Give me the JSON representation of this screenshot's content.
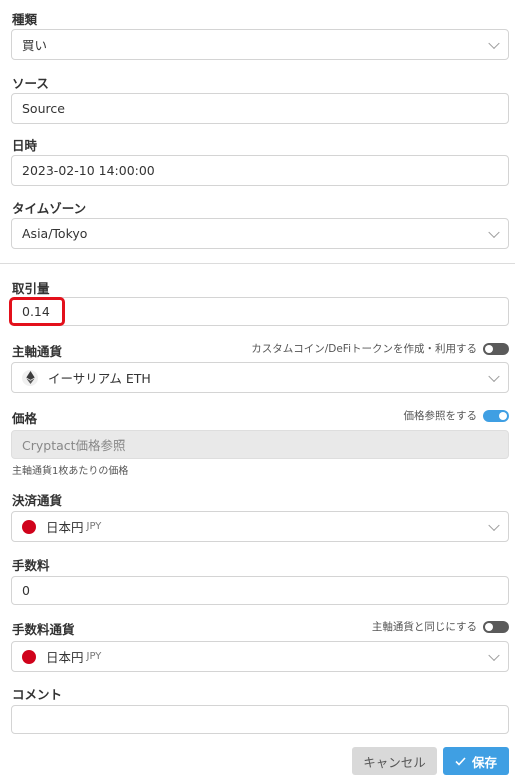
{
  "type": {
    "label": "種類",
    "value": "買い"
  },
  "source": {
    "label": "ソース",
    "value": "Source"
  },
  "datetime": {
    "label": "日時",
    "value": "2023-02-10 14:00:00"
  },
  "timezone": {
    "label": "タイムゾーン",
    "value": "Asia/Tokyo"
  },
  "amount": {
    "label": "取引量",
    "value": "0.14"
  },
  "base_currency": {
    "label": "主軸通貨",
    "toggle_label": "カスタムコイン/DeFiトークンを作成・利用する",
    "toggle_on": false,
    "value": "イーサリアム ETH",
    "icon": "ethereum-icon"
  },
  "price": {
    "label": "価格",
    "toggle_label": "価格参照をする",
    "toggle_on": true,
    "placeholder": "Cryptact価格参照",
    "hint": "主軸通貨1枚あたりの価格"
  },
  "settlement_currency": {
    "label": "決済通貨",
    "value": "日本円",
    "code": "JPY",
    "icon": "japan-flag-icon"
  },
  "fee": {
    "label": "手数料",
    "value": "0"
  },
  "fee_currency": {
    "label": "手数料通貨",
    "toggle_label": "主軸通貨と同じにする",
    "toggle_on": false,
    "value": "日本円",
    "code": "JPY",
    "icon": "japan-flag-icon"
  },
  "comment": {
    "label": "コメント",
    "value": ""
  },
  "buttons": {
    "cancel": "キャンセル",
    "save": "保存"
  },
  "colors": {
    "accent": "#3f9fe3",
    "highlight": "#e3101b",
    "flag_red": "#d0021b"
  }
}
